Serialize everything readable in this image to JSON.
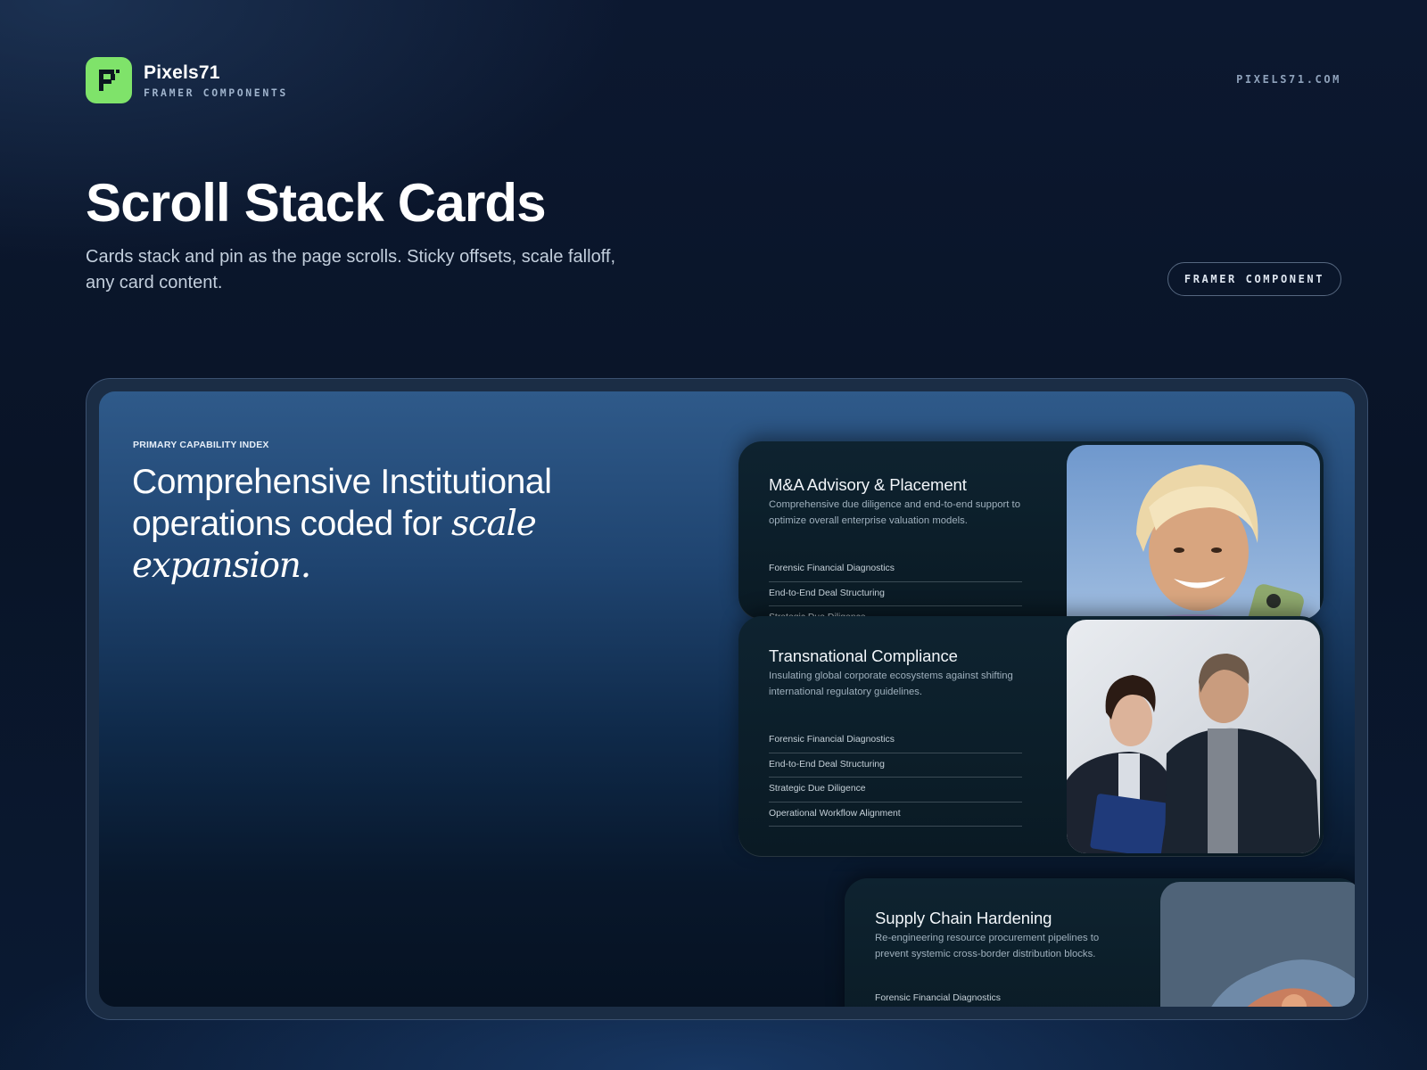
{
  "brand": {
    "name": "Pixels71",
    "subtitle": "FRAMER COMPONENTS",
    "logo_color": "#7fe36a",
    "logo_icon": "pixel-p-logo-icon"
  },
  "header": {
    "site_url": "PIXELS71.COM"
  },
  "hero": {
    "title": "Scroll Stack Cards",
    "description": "Cards stack and pin as the page scrolls. Sticky offsets, scale falloff, any card content.",
    "badge": "FRAMER COMPONENT"
  },
  "demo": {
    "eyebrow": "PRIMARY CAPABILITY INDEX",
    "title_line1": "Comprehensive Institutional",
    "title_line2": "operations coded for",
    "title_accent": "scale expansion.",
    "cards": [
      {
        "title": "M&A Advisory & Placement",
        "description": "Comprehensive due diligence and end-to-end  support to optimize overall enterprise valuation models.",
        "items": [
          "Forensic Financial Diagnostics",
          "End-to-End Deal Structuring",
          "Strategic Due Diligence"
        ],
        "image": "smiling-person-portrait"
      },
      {
        "title": "Transnational Compliance",
        "description": "Insulating global corporate ecosystems against shifting international regulatory guidelines.",
        "items": [
          "Forensic Financial Diagnostics",
          "End-to-End Deal Structuring",
          "Strategic Due Diligence",
          "Operational Workflow Alignment"
        ],
        "image": "two-professionals-portrait"
      },
      {
        "title": "Supply Chain Hardening",
        "description": "Re-engineering resource procurement pipelines to prevent systemic cross-border distribution blocks.",
        "items": [
          "Forensic Financial Diagnostics"
        ],
        "image": "mineral-rock"
      }
    ]
  }
}
